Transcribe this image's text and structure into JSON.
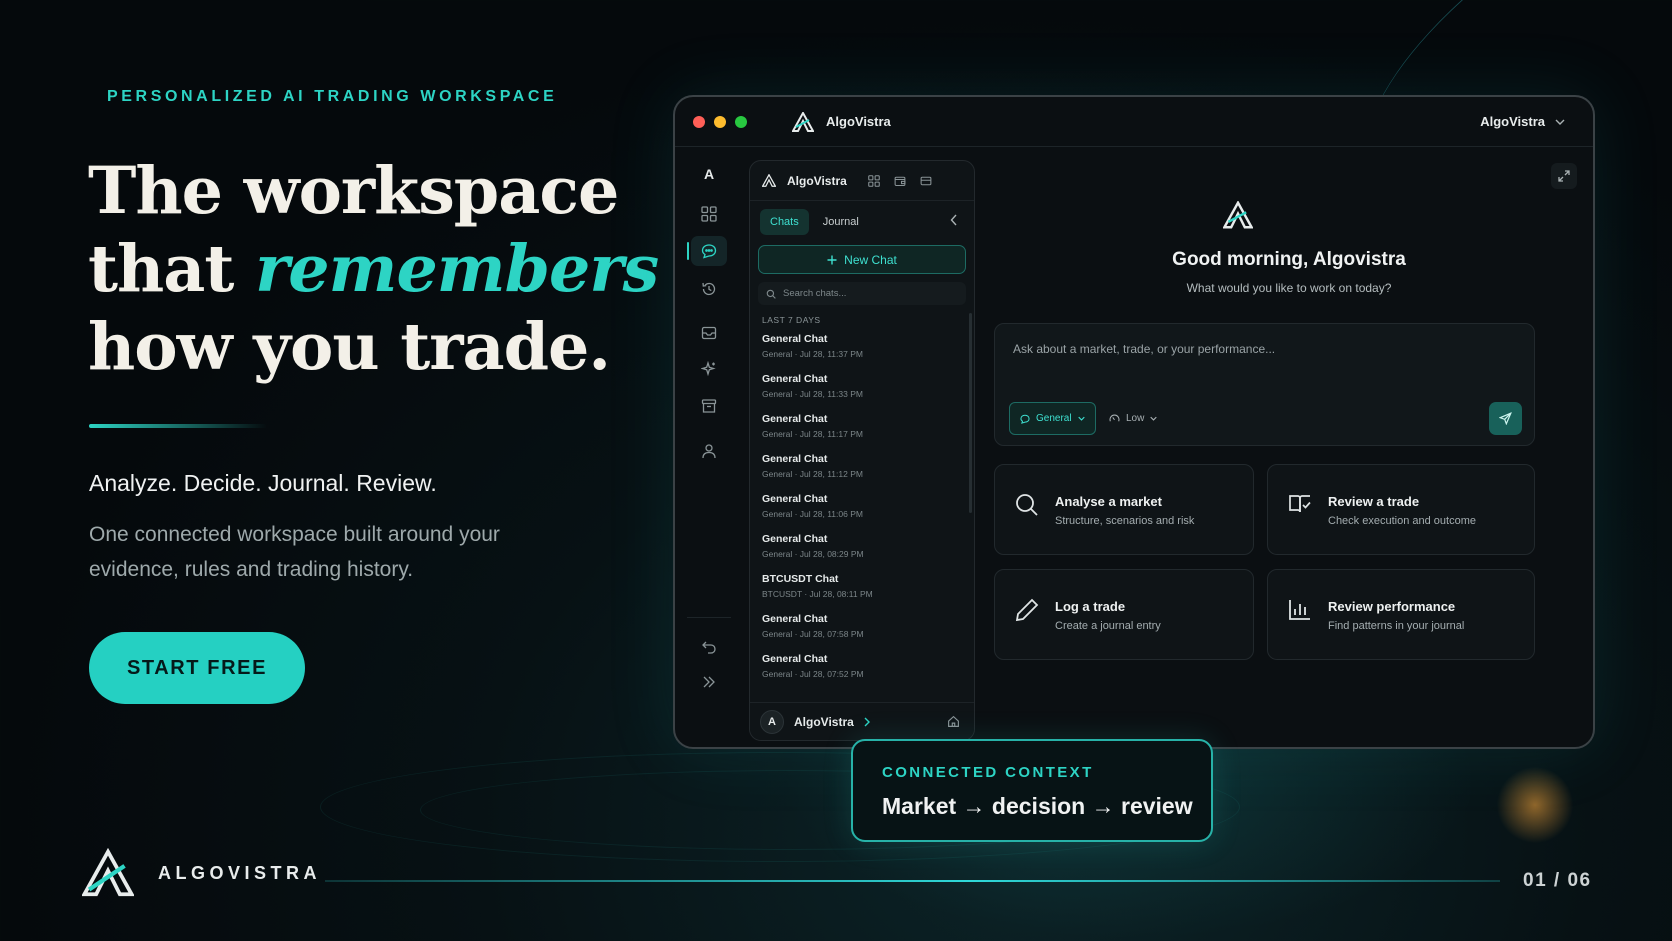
{
  "hero": {
    "eyebrow": "PERSONALIZED AI TRADING WORKSPACE",
    "headline_line1": "The workspace",
    "headline_line2_prefix": "that ",
    "headline_line2_accent": "remembers",
    "headline_line3": "how you trade.",
    "tagline": "Analyze. Decide. Journal. Review.",
    "description": "One connected workspace built around your evidence, rules and trading history.",
    "cta_label": "START FREE"
  },
  "footer": {
    "brand_name": "ALGOVISTRA",
    "pager": "01 / 06"
  },
  "window": {
    "title": "AlgoVistra",
    "account_name": "AlgoVistra",
    "traffic_lights": [
      "#ff5f57",
      "#febc2e",
      "#28c840"
    ]
  },
  "rail": {
    "top_letter": "A",
    "items": [
      "grid-icon",
      "chat-icon",
      "history-icon",
      "inbox-icon",
      "sparkle-icon",
      "archive-icon",
      "user-icon"
    ],
    "bottom_items": [
      "undo-icon",
      "double-chevron-right-icon"
    ]
  },
  "sidebar": {
    "header_title": "AlgoVistra",
    "tabs": [
      "Chats",
      "Journal"
    ],
    "new_chat_label": "New Chat",
    "search_placeholder": "Search chats...",
    "group_label": "LAST 7 DAYS",
    "chats": [
      {
        "title": "General Chat",
        "meta": "General · Jul 28, 11:37 PM"
      },
      {
        "title": "General Chat",
        "meta": "General · Jul 28, 11:33 PM"
      },
      {
        "title": "General Chat",
        "meta": "General · Jul 28, 11:17 PM"
      },
      {
        "title": "General Chat",
        "meta": "General · Jul 28, 11:12 PM"
      },
      {
        "title": "General Chat",
        "meta": "General · Jul 28, 11:06 PM"
      },
      {
        "title": "General Chat",
        "meta": "General · Jul 28, 08:29 PM"
      },
      {
        "title": "BTCUSDT Chat",
        "meta": "BTCUSDT · Jul 28, 08:11 PM"
      },
      {
        "title": "General Chat",
        "meta": "General · Jul 28, 07:58 PM"
      },
      {
        "title": "General Chat",
        "meta": "General · Jul 28, 07:52 PM"
      }
    ],
    "footer_avatar": "A",
    "footer_name": "AlgoVistra"
  },
  "main": {
    "greeting": "Good morning, Algovistra",
    "subgreeting": "What would you like to work on today?",
    "composer_placeholder": "Ask about a market, trade, or your performance...",
    "mode_label": "General",
    "effort_label": "Low",
    "cards": [
      {
        "title": "Analyse a market",
        "subtitle": "Structure, scenarios and risk",
        "icon": "search-icon"
      },
      {
        "title": "Review a trade",
        "subtitle": "Check execution and outcome",
        "icon": "book-check-icon"
      },
      {
        "title": "Log a trade",
        "subtitle": "Create a journal entry",
        "icon": "pen-icon"
      },
      {
        "title": "Review performance",
        "subtitle": "Find patterns in your journal",
        "icon": "bar-chart-icon"
      }
    ]
  },
  "context_card": {
    "label": "CONNECTED CONTEXT",
    "text": "Market → decision → review"
  },
  "colors": {
    "accent": "#2dd4c4",
    "background": "#05090c",
    "cta": "#25d0c2"
  }
}
